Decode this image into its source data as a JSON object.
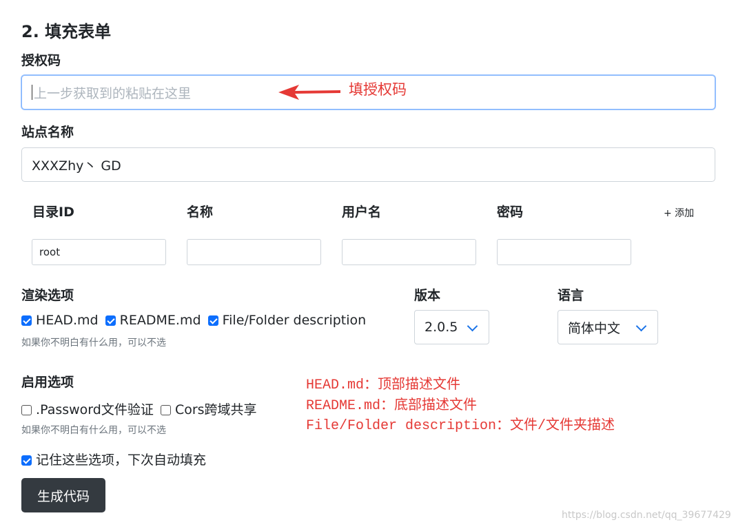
{
  "section": {
    "title": "2. 填充表单"
  },
  "auth_code": {
    "label": "授权码",
    "placeholder": "上一步获取到的粘贴在这里",
    "value": ""
  },
  "site_name": {
    "label": "站点名称",
    "value": "XXXZhy丶 GD"
  },
  "directory_table": {
    "headers": [
      "目录ID",
      "名称",
      "用户名",
      "密码"
    ],
    "add_label": "+ 添加",
    "rows": [
      {
        "id": "root",
        "name": "",
        "username": "",
        "password": ""
      }
    ]
  },
  "render_options": {
    "label": "渲染选项",
    "options": [
      {
        "label": "HEAD.md",
        "checked": true
      },
      {
        "label": "README.md",
        "checked": true
      },
      {
        "label": "File/Folder description",
        "checked": true
      }
    ],
    "hint": "如果你不明白有什么用，可以不选"
  },
  "version": {
    "label": "版本",
    "value": "2.0.5"
  },
  "language": {
    "label": "语言",
    "value": "简体中文"
  },
  "enable_options": {
    "label": "启用选项",
    "options": [
      {
        "label": ".Password文件验证",
        "checked": false
      },
      {
        "label": "Cors跨域共享",
        "checked": false
      }
    ],
    "hint": "如果你不明白有什么用，可以不选"
  },
  "remember": {
    "label": "记住这些选项，下次自动填充",
    "checked": true
  },
  "generate_button": {
    "label": "生成代码"
  },
  "annotations": {
    "arrow_note": "填授权码",
    "notes": [
      "HEAD.md：顶部描述文件",
      "README.md：底部描述文件",
      "File/Folder description：文件/文件夹描述"
    ],
    "color": "#e53935"
  },
  "watermark": "https://blog.csdn.net/qq_39677429",
  "colors": {
    "accent": "#0d6efd",
    "button_bg": "#343a40",
    "focus_border": "#86b7fe"
  }
}
